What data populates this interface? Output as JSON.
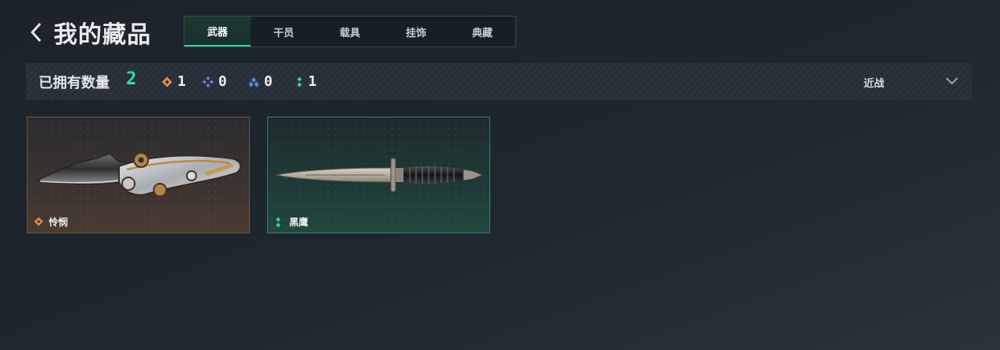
{
  "header": {
    "title": "我的藏品",
    "back_icon": "chevron-left-icon"
  },
  "tabs": [
    {
      "label": "武器",
      "active": true
    },
    {
      "label": "干员",
      "active": false
    },
    {
      "label": "载具",
      "active": false
    },
    {
      "label": "挂饰",
      "active": false
    },
    {
      "label": "典藏",
      "active": false
    }
  ],
  "stats": {
    "owned_label": "已拥有数量",
    "owned_count": "2",
    "rarities": [
      {
        "icon": "orange-rarity-icon",
        "color": "#e08a4a",
        "count": "1"
      },
      {
        "icon": "purple-rarity-icon",
        "color": "#8e6ae6",
        "count": "0"
      },
      {
        "icon": "blue-rarity-icon",
        "color": "#4a90e2",
        "count": "0"
      },
      {
        "icon": "green-rarity-icon",
        "color": "#2fd39a",
        "count": "1"
      }
    ],
    "filter_label": "近战",
    "filter_icon": "chevron-down-icon"
  },
  "items": [
    {
      "name": "怜悯",
      "rarity": "orange",
      "weapon_icon": "folding-knife-icon"
    },
    {
      "name": "黑鹰",
      "rarity": "green",
      "weapon_icon": "dagger-icon"
    }
  ],
  "colors": {
    "accent": "#2fe0a3",
    "orange": "#e08a4a",
    "purple": "#8e6ae6",
    "blue": "#4a90e2",
    "green": "#2fd39a"
  }
}
